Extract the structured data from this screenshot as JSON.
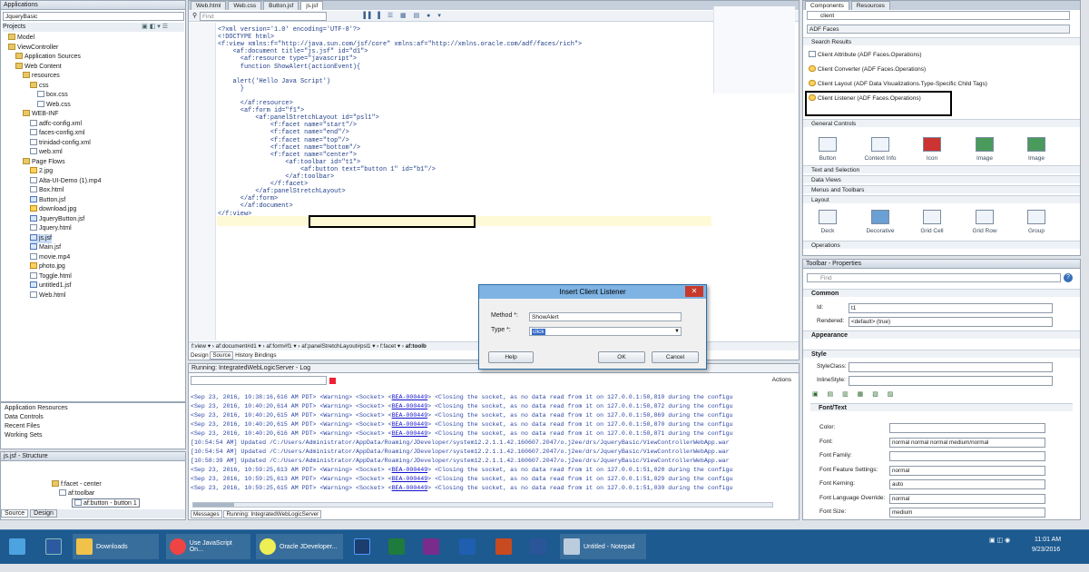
{
  "left": {
    "applications_title": "Applications",
    "app_selector": "JqueryBasic",
    "projects_label": "Projects",
    "tree": [
      "Model",
      "ViewController",
      "Application Sources",
      "Web Content",
      "resources",
      "css",
      "box.css",
      "Web.css",
      "WEB-INF",
      "adfc-config.xml",
      "faces-config.xml",
      "trinidad-config.xml",
      "web.xml",
      "Page Flows",
      "2.jpg",
      "Alta-UI-Demo (1).mp4",
      "Box.html",
      "Button.jsf",
      "download.jpg",
      "JqueryButton.jsf",
      "Jquery.html",
      "js.jsf",
      "Main.jsf",
      "movie.mp4",
      "photo.jpg",
      "Toggle.html",
      "untitled1.jsf",
      "Web.html"
    ],
    "sections": [
      "Application Resources",
      "Data Controls",
      "Recent Files",
      "Working Sets"
    ],
    "structure_title": "js.jsf - Structure",
    "structure_items": [
      "f:facet - center",
      "af:toolbar",
      "af:button - button 1"
    ],
    "bottom_tabs": [
      "Source",
      "Design"
    ]
  },
  "editor": {
    "tabs": [
      "Web.html",
      "Web.css",
      "Button.jsf",
      "js.jsf"
    ],
    "find_placeholder": "Find",
    "code": [
      "<?xml version='1.0' encoding='UTF-8'?>",
      "<!DOCTYPE html>",
      "<f:view xmlns:f=\"http://java.sun.com/jsf/core\" xmlns:af=\"http://xmlns.oracle.com/adf/faces/rich\">",
      "    <af:document title=\"js.jsf\" id=\"d1\">",
      "      <af:resource type=\"javascript\">",
      "      function ShowAlert(actionEvent){",
      "",
      "    alert('Hello Java Script')",
      "      }",
      "",
      "      </af:resource>",
      "      <af:form id=\"f1\">",
      "          <af:panelStretchLayout id=\"psl1\">",
      "              <f:facet name=\"start\"/>",
      "              <f:facet name=\"end\"/>",
      "              <f:facet name=\"top\"/>",
      "              <f:facet name=\"bottom\"/>",
      "              <f:facet name=\"center\">",
      "                  <af:toolbar id=\"t1\">",
      "                      <af:button text=\"button 1\" id=\"b1\"/>",
      "                  </af:toolbar>",
      "              </f:facet>",
      "          </af:panelStretchLayout>",
      "      </af:form>",
      "      </af:document>",
      "</f:view>"
    ],
    "breadcrumb": [
      "f:view",
      "af:document#d1",
      "af:form#f1",
      "af:panelStretchLayout#psl1",
      "f:facet",
      "af:toolb"
    ],
    "bottom_tabs": [
      "Design",
      "Source",
      "History",
      "Bindings"
    ]
  },
  "log": {
    "title": "Running: IntegratedWebLogicServer - Log",
    "actions": "Actions",
    "lines": [
      [
        "<Sep 23, 2016, 10:38:16,616 AM PDT> <Warning> <Socket> <",
        "BEA-000449",
        "> <Closing the socket, as no data read from it on 127.0.0.1:50,810 during the configu"
      ],
      [
        "<Sep 23, 2016, 10:40:20,614 AM PDT> <Warning> <Socket> <",
        "BEA-000449",
        "> <Closing the socket, as no data read from it on 127.0.0.1:50,872 during the configu"
      ],
      [
        "<Sep 23, 2016, 10:40:20,615 AM PDT> <Warning> <Socket> <",
        "BEA-000449",
        "> <Closing the socket, as no data read from it on 127.0.0.1:50,869 during the configu"
      ],
      [
        "<Sep 23, 2016, 10:40:20,615 AM PDT> <Warning> <Socket> <",
        "BEA-000449",
        "> <Closing the socket, as no data read from it on 127.0.0.1:50,870 during the configu"
      ],
      [
        "<Sep 23, 2016, 10:40:20,616 AM PDT> <Warning> <Socket> <",
        "BEA-000449",
        "> <Closing the socket, as no data read from it on 127.0.0.1:50,871 during the configu"
      ],
      [
        "[10:54:54 AM] Updated /C:/Users/Administrator/AppData/Roaming/JDeveloper/system12.2.1.1.42.160607.2047/o.j2ee/drs/JqueryBasic/ViewControllerWebApp.war",
        "",
        ""
      ],
      [
        "[10:54:54 AM] Updated /C:/Users/Administrator/AppData/Roaming/JDeveloper/system12.2.1.1.42.160607.2047/o.j2ee/drs/JqueryBasic/ViewControllerWebApp.war",
        "",
        ""
      ],
      [
        "[10:58:39 AM] Updated /C:/Users/Administrator/AppData/Roaming/JDeveloper/system12.2.1.1.42.160607.2047/o.j2ee/drs/JqueryBasic/ViewControllerWebApp.war",
        "",
        ""
      ],
      [
        "<Sep 23, 2016, 10:59:25,613 AM PDT> <Warning> <Socket> <",
        "BEA-000449",
        "> <Closing the socket, as no data read from it on 127.0.0.1:51,028 during the configu"
      ],
      [
        "<Sep 23, 2016, 10:59:25,613 AM PDT> <Warning> <Socket> <",
        "BEA-000449",
        "> <Closing the socket, as no data read from it on 127.0.0.1:51,029 during the configu"
      ],
      [
        "<Sep 23, 2016, 10:59:25,615 AM PDT> <Warning> <Socket> <",
        "BEA-000449",
        "> <Closing the socket, as no data read from it on 127.0.0.1:51,030 during the configu"
      ]
    ],
    "bottom_tabs": [
      "Messages",
      "Running: IntegratedWebLogicServer"
    ]
  },
  "dialog": {
    "title": "Insert Client Listener",
    "method_label": "Method *:",
    "method_value": "ShowAlert",
    "type_label": "Type *:",
    "type_value": "click",
    "help": "Help",
    "ok": "OK",
    "cancel": "Cancel"
  },
  "components": {
    "tabs": [
      "Components",
      "Resources"
    ],
    "search_value": "client",
    "library": "ADF Faces",
    "search_results": "Search Results",
    "results": [
      "Client Attribute (ADF Faces.Operations)",
      "Client Converter (ADF Faces.Operations)",
      "Client Layout (ADF Data Visualizations.Type-Specific Child Tags)",
      "Client Listener (ADF Faces.Operations)"
    ],
    "general_controls": "General Controls",
    "gc_items": [
      "Button",
      "Context Info",
      "Icon",
      "Image",
      "Image"
    ],
    "groups": [
      "Text and Selection",
      "Data Views",
      "Menus and Toolbars",
      "Layout"
    ],
    "layout_items": [
      "Deck",
      "Decorative",
      "Grid Cell",
      "Grid Row",
      "Group"
    ],
    "operations": "Operations"
  },
  "props": {
    "title": "Toolbar - Properties",
    "find_placeholder": "Find",
    "common": "Common",
    "id_label": "Id:",
    "id_value": "t1",
    "rendered_label": "Rendered:",
    "rendered_value": "<default> (true)",
    "appearance": "Appearance",
    "style": "Style",
    "styleclass_label": "StyleClass:",
    "inlinestyle_label": "InlineStyle:",
    "font_text": "Font/Text",
    "font_props": [
      [
        "Color:",
        ""
      ],
      [
        "Font:",
        "normal normal normal medium/normal"
      ],
      [
        "Font Family:",
        ""
      ],
      [
        "Font Feature Settings:",
        "normal"
      ],
      [
        "Font Kerning:",
        "auto"
      ],
      [
        "Font Language Override:",
        "normal"
      ],
      [
        "Font Size:",
        "medium"
      ]
    ]
  },
  "taskbar": {
    "items": [
      "Downloads",
      "Use JavaScript On...",
      "Oracle JDeveloper...",
      "",
      "",
      "",
      "",
      "",
      "",
      "Untitled - Notepad"
    ],
    "time": "11:01 AM",
    "date": "9/23/2016"
  },
  "colors": {
    "taskbar": "#1d5a8f",
    "highlight": "#fffad6",
    "selection": "#c9dcf5"
  }
}
